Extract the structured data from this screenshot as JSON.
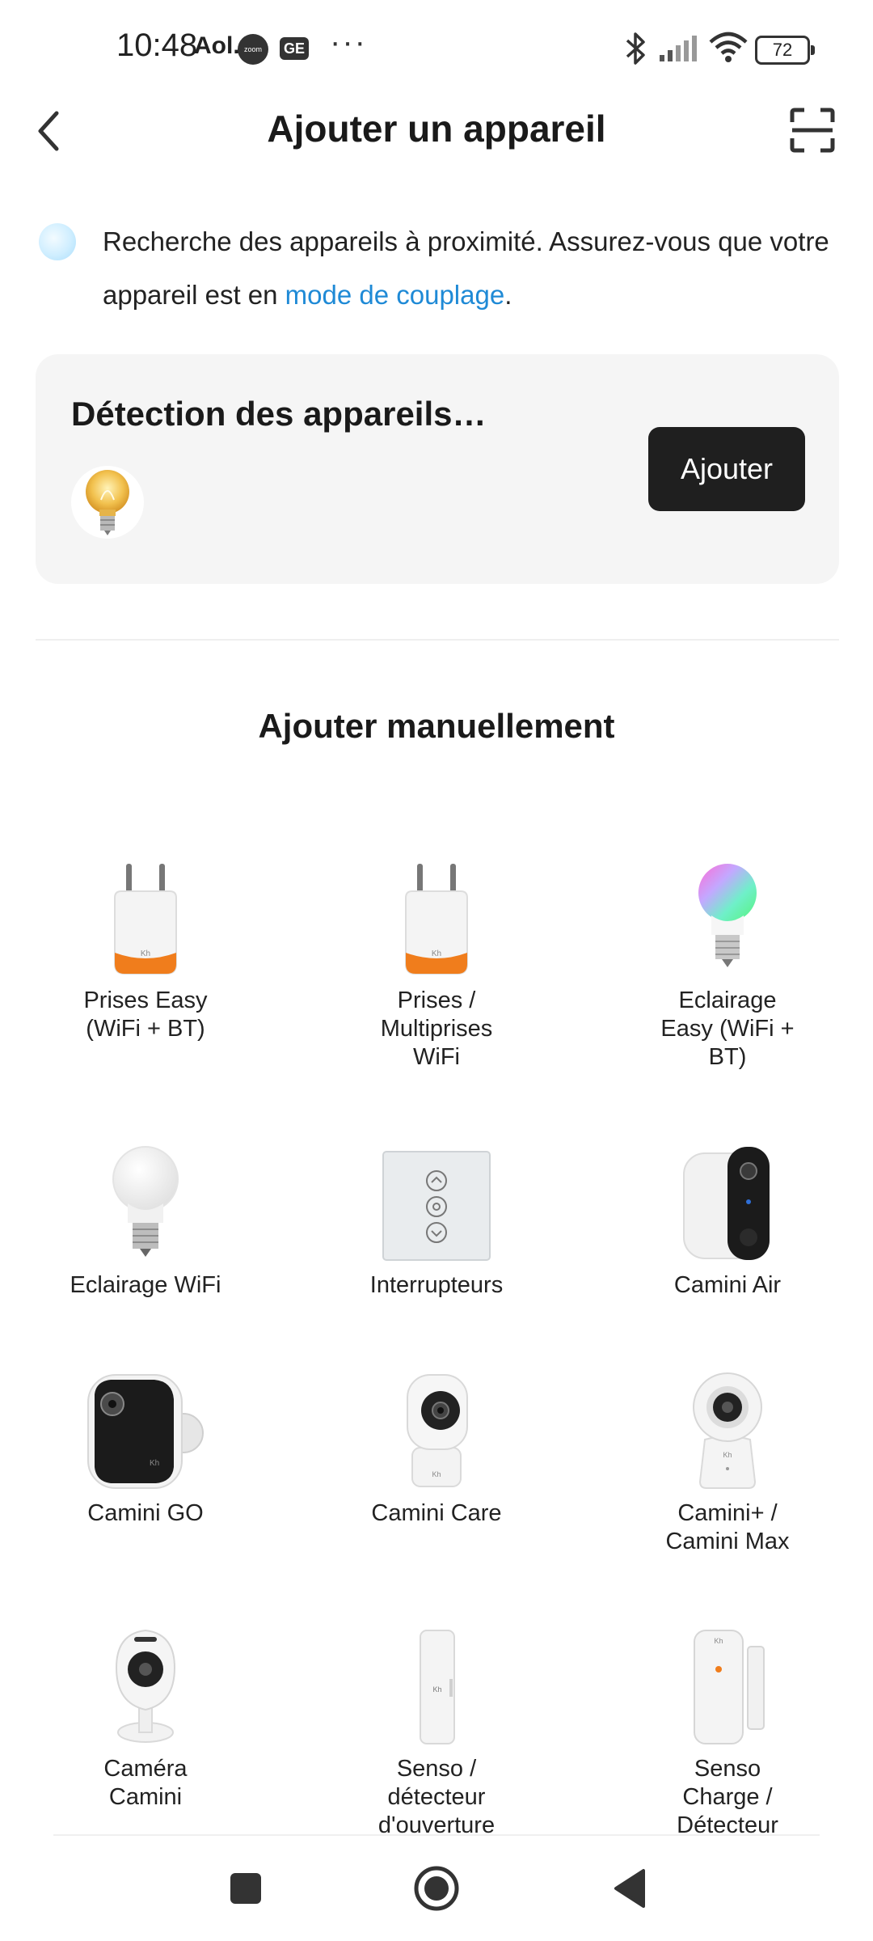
{
  "status_bar": {
    "time": "10:48",
    "aol": "Aol.",
    "zoom_badge": "zoom",
    "ge_badge": "GE",
    "overflow": "···",
    "battery": "72"
  },
  "header": {
    "title": "Ajouter un appareil",
    "back_icon": "chevron-left-icon",
    "scan_icon": "scan-frame-icon"
  },
  "info": {
    "text_before": "Recherche des appareils à proximité. Assurez-vous que votre appareil est en ",
    "link": "mode de couplage",
    "text_after": "."
  },
  "detection": {
    "title": "Détection des appareils…",
    "button": "Ajouter"
  },
  "manual": {
    "title": "Ajouter manuellement",
    "devices": [
      {
        "label": "Prises Easy\n(WiFi + BT)",
        "icon": "smart-plug-icon"
      },
      {
        "label": "Prises /\nMultiprises\nWiFi",
        "icon": "smart-plug-icon"
      },
      {
        "label": "Eclairage\nEasy (WiFi +\nBT)",
        "icon": "rgb-bulb-icon"
      },
      {
        "label": "Eclairage WiFi",
        "icon": "bulb-icon"
      },
      {
        "label": "Interrupteurs",
        "icon": "switch-panel-icon"
      },
      {
        "label": "Camini Air",
        "icon": "doorbell-camera-icon"
      },
      {
        "label": "Camini GO",
        "icon": "battery-camera-icon"
      },
      {
        "label": "Camini Care",
        "icon": "indoor-camera-icon"
      },
      {
        "label": "Camini+ /\nCamini Max",
        "icon": "dome-camera-icon"
      },
      {
        "label": "Caméra\nCamini",
        "icon": "drop-camera-icon"
      },
      {
        "label": "Senso /\ndétecteur\nd'ouverture",
        "icon": "door-sensor-icon"
      },
      {
        "label": "Senso\nCharge /\nDétecteur",
        "icon": "door-sensor-icon"
      }
    ]
  },
  "nav": {
    "recents_icon": "square-icon",
    "home_icon": "home-circle-icon",
    "back_icon": "triangle-back-icon"
  }
}
